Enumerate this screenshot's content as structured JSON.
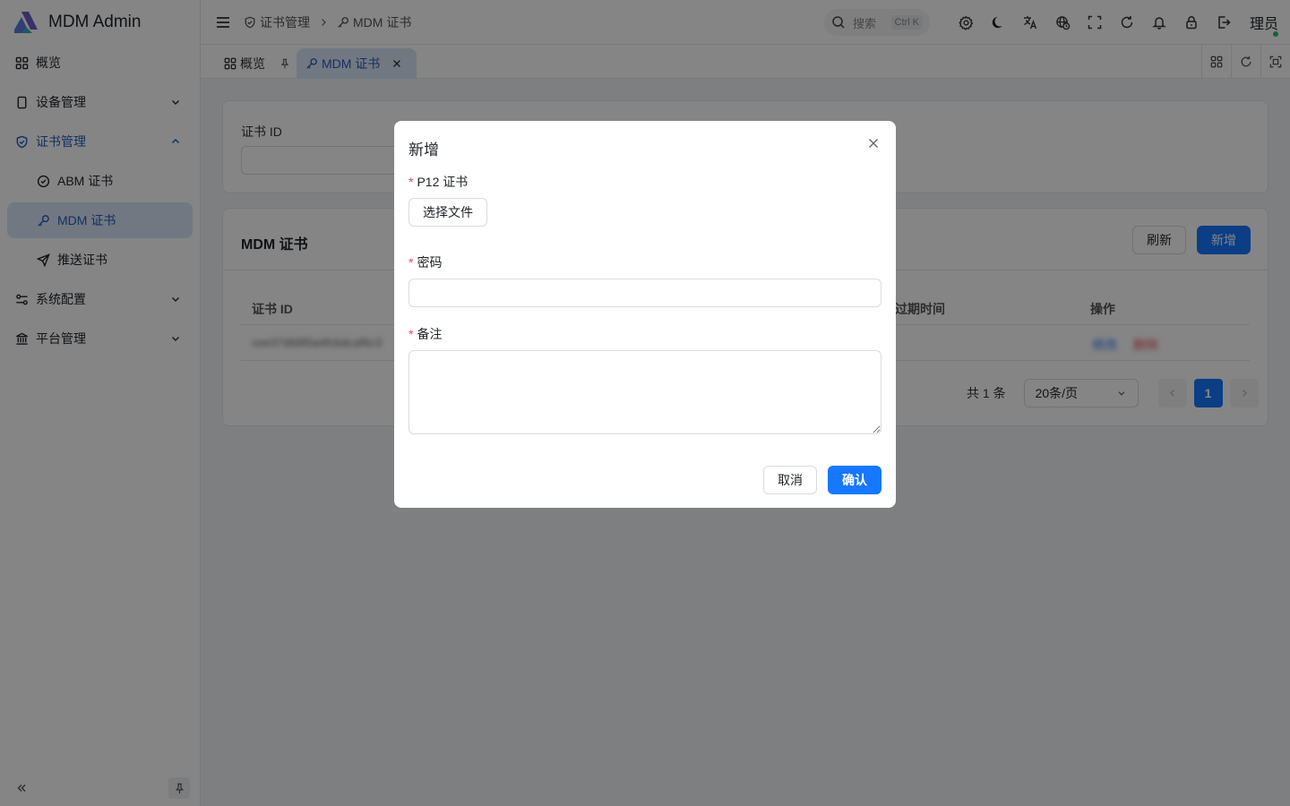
{
  "brand": {
    "title": "MDM Admin"
  },
  "sidebar": {
    "items": [
      {
        "label": "概览"
      },
      {
        "label": "设备管理"
      },
      {
        "label": "证书管理"
      },
      {
        "label": "ABM 证书"
      },
      {
        "label": "MDM 证书"
      },
      {
        "label": "推送证书"
      },
      {
        "label": "系统配置"
      },
      {
        "label": "平台管理"
      }
    ]
  },
  "header": {
    "breadcrumb": [
      "证书管理",
      "MDM 证书"
    ],
    "search_placeholder": "搜索",
    "search_shortcut": "Ctrl K",
    "user": "理员"
  },
  "tabs": [
    {
      "label": "概览"
    },
    {
      "label": "MDM 证书"
    }
  ],
  "filter": {
    "label": "证书 ID"
  },
  "table_card": {
    "title": "MDM 证书",
    "refresh_label": "刷新",
    "add_label": "新增",
    "columns": [
      "证书 ID",
      "过期时间",
      "操作"
    ],
    "rows": [
      {
        "id": "cee37d68f0a4fcbdcaf6c3",
        "edit": "修改",
        "delete": "删除"
      }
    ],
    "pagination": {
      "total_text": "共 1 条",
      "page_size": "20条/页",
      "current_page": "1"
    }
  },
  "modal": {
    "title": "新增",
    "fields": {
      "p12_label": "P12 证书",
      "file_button": "选择文件",
      "password_label": "密码",
      "remark_label": "备注"
    },
    "cancel_label": "取消",
    "confirm_label": "确认"
  },
  "colors": {
    "primary": "#1677ff",
    "active_menu_bg": "#dbe7f8",
    "danger": "#e34d59"
  }
}
